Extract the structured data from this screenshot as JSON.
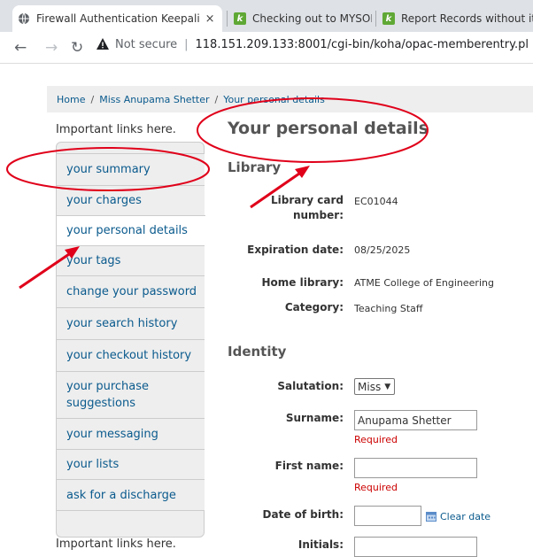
{
  "browser": {
    "tabs": [
      {
        "title": "Firewall Authentication Keepali",
        "close": "×"
      },
      {
        "title": "Checking out to MYSORE, ATM",
        "close": "×"
      },
      {
        "title": "Report Records without items"
      }
    ],
    "not_secure": "Not secure",
    "url": "118.151.209.133:8001/cgi-bin/koha/opac-memberentry.pl"
  },
  "breadcrumb": {
    "home": "Home",
    "user": "Miss Anupama Shetter",
    "current": "Your personal details",
    "sep": "/"
  },
  "sidebar": {
    "heading": "Important links here.",
    "footer_heading": "Important links here.",
    "items": [
      "your summary",
      "your charges",
      "your personal details",
      "your tags",
      "change your password",
      "your search history",
      "your checkout history",
      "your purchase suggestions",
      "your messaging",
      "your lists",
      "ask for a discharge"
    ]
  },
  "main": {
    "title": "Your personal details",
    "library_section": "Library",
    "library_card_label_1": "Library card",
    "library_card_label_2": "number:",
    "library_card_value": "EC01044",
    "expiration_label": "Expiration date:",
    "expiration_value": "08/25/2025",
    "home_library_label": "Home library:",
    "home_library_value": "ATME College of Engineering",
    "category_label": "Category:",
    "category_value": "Teaching Staff",
    "identity_section": "Identity",
    "salutation_label": "Salutation:",
    "salutation_value": "Miss",
    "surname_label": "Surname:",
    "surname_value": "Anupama Shetter",
    "surname_required": "Required",
    "firstname_label": "First name:",
    "firstname_value": "",
    "firstname_required": "Required",
    "dob_label": "Date of birth:",
    "dob_value": "",
    "clear_date": "Clear date",
    "initials_label": "Initials:"
  },
  "colors": {
    "link": "#0a5a8d",
    "required": "#cc0000",
    "annotation": "#e0001a"
  }
}
